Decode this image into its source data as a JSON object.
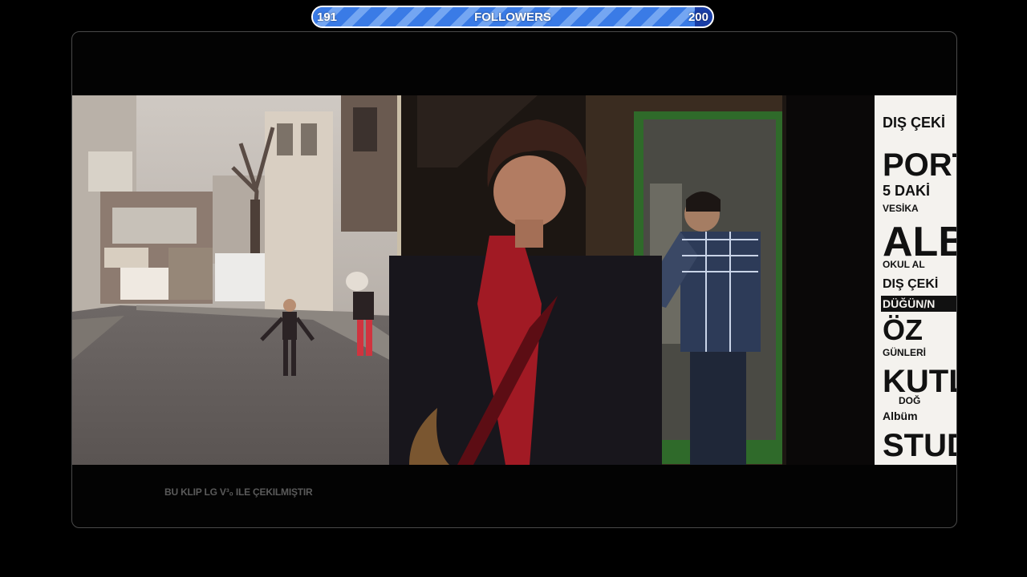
{
  "follower_goal": {
    "current": "191",
    "label": "FOLLOWERS",
    "target": "200",
    "progress_fraction": 0.955,
    "bar_color": "#3a7be6",
    "stripe_color": "#74a6f2",
    "track_color": "#1a3fa8"
  },
  "video": {
    "caption": "BU KLIP LG V³₀ ILE ÇEKILMIŞTIR",
    "poster_lines": [
      "DIŞ ÇEKİ",
      "PORT",
      "5 DAKİ",
      "VESİKA",
      "ALB",
      "OKUL AL",
      "DIŞ ÇEKİ",
      "DÜĞÜN/N",
      "ÖZ",
      "GÜNLERİ",
      "KUTLA",
      "DOĞ",
      "Albüm",
      "STUDY"
    ]
  }
}
